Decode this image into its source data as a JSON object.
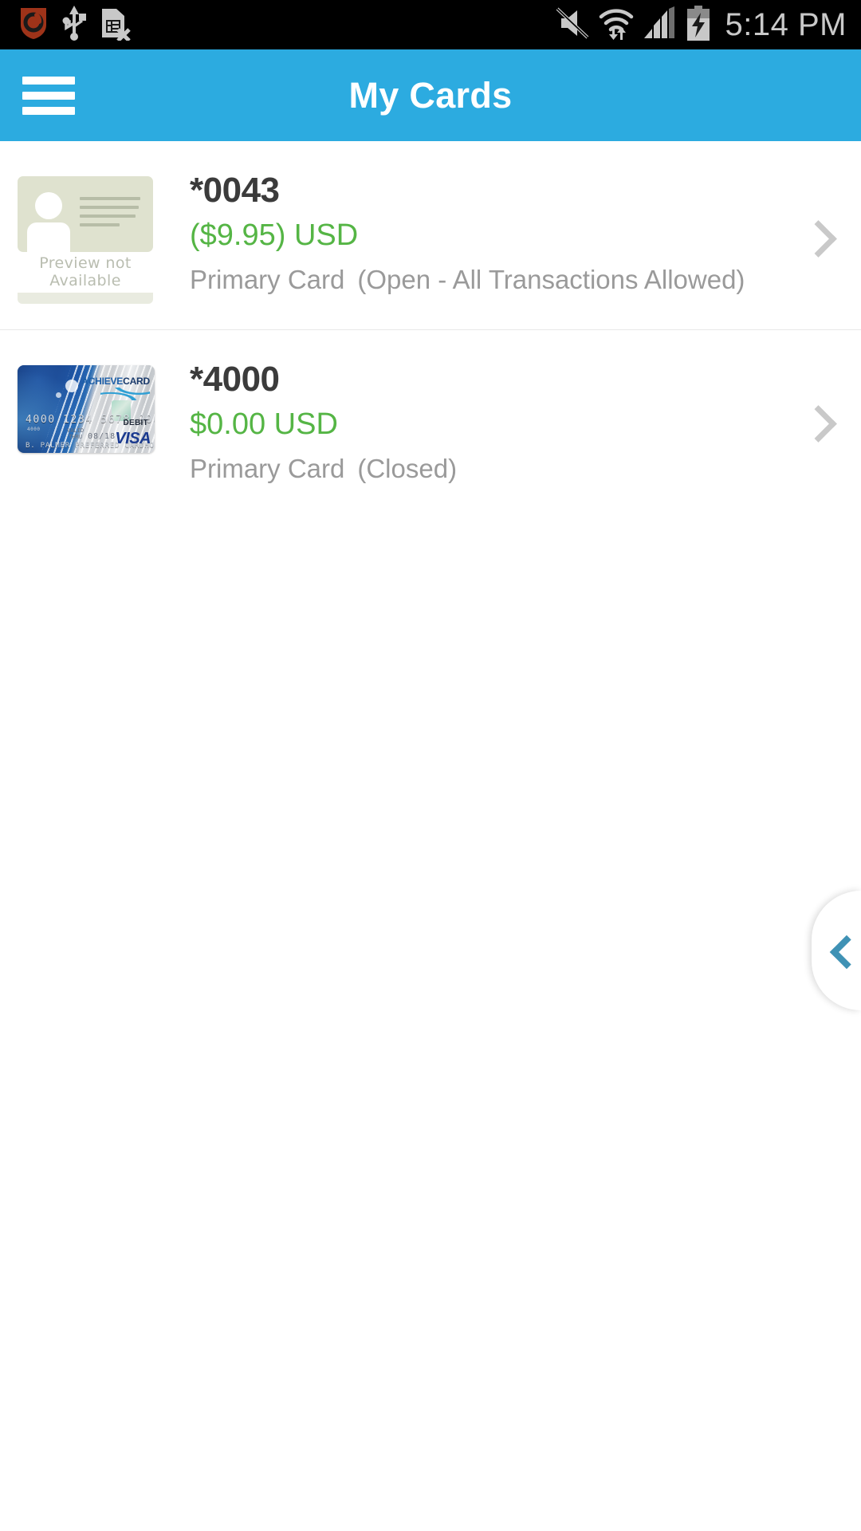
{
  "status_bar": {
    "time": "5:14 PM",
    "left_icons": [
      {
        "name": "security-shield-icon",
        "label": "Security Shield"
      },
      {
        "name": "usb-icon",
        "label": "USB Connected"
      },
      {
        "name": "sim-card-missing-icon",
        "label": "No SIM Card"
      }
    ],
    "right_icons": [
      {
        "name": "volume-mute-icon",
        "label": "Muted"
      },
      {
        "name": "wifi-icon",
        "label": "Wi-Fi Connected"
      },
      {
        "name": "cellular-signal-icon",
        "label": "Signal"
      },
      {
        "name": "battery-charging-icon",
        "label": "Battery Charging"
      }
    ],
    "colors": {
      "background": "#000000",
      "text": "#c9c9c9",
      "icon": "#c8c8c8",
      "shield": "#9e3319"
    }
  },
  "app_bar": {
    "title": "My Cards",
    "menu_icon": "hamburger-menu-icon",
    "background": "#2cabe0",
    "text_color": "#ffffff"
  },
  "cards": [
    {
      "number": "*0043",
      "balance": "($9.95) USD",
      "card_type": "Primary Card",
      "status": "(Open - All Transactions Allowed)",
      "thumbnail": {
        "type": "placeholder",
        "caption": "Preview not Available"
      },
      "chevron_icon": "chevron-right-icon"
    },
    {
      "number": "*4000",
      "balance": "$0.00 USD",
      "card_type": "Primary Card",
      "status": "(Closed)",
      "thumbnail": {
        "type": "visa-debit-card",
        "brand_prefix": "ACHIEVE",
        "brand_suffix": "CARD",
        "card_number": "4000 1234 5678 9000",
        "small_number": "4000",
        "valid_label_line1": "VALID",
        "valid_label_line2": "THRU",
        "expiry": "08/18",
        "cardholder": "B. PALMER PREFERRED CARDHOLDER",
        "debit_label": "DEBIT",
        "network_logo": "VISA"
      },
      "chevron_icon": "chevron-right-icon"
    }
  ],
  "edge_tab": {
    "icon": "chevron-left-icon",
    "accent_color": "#3f92b5"
  },
  "theme": {
    "accent": "#2cabe0",
    "balance_green": "#55b545",
    "muted_grey": "#9a9a9a",
    "card_number_dark": "#3b3b3b",
    "divider": "#e8e8e8"
  }
}
